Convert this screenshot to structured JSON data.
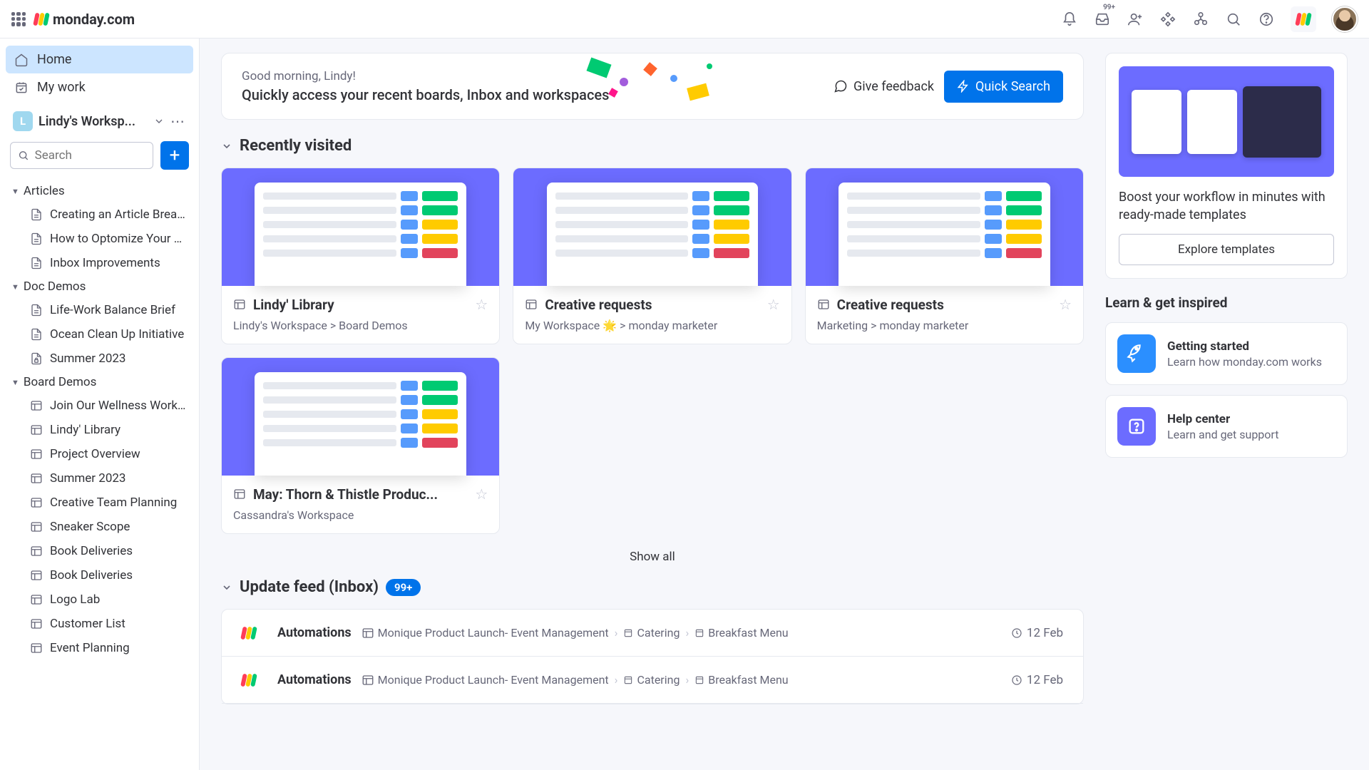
{
  "brand": "monday.com",
  "topbar": {
    "inbox_badge": "99+"
  },
  "sidebar": {
    "home": "Home",
    "mywork": "My work",
    "workspace": {
      "initial": "L",
      "name": "Lindy's Worksp..."
    },
    "search_placeholder": "Search",
    "groups": [
      {
        "name": "Articles",
        "type": "folder",
        "children": [
          {
            "label": "Creating an Article Break...",
            "type": "doc"
          },
          {
            "label": "How to Optomize Your A...",
            "type": "doc"
          },
          {
            "label": "Inbox Improvements",
            "type": "doc"
          }
        ]
      },
      {
        "name": "Doc Demos",
        "type": "folder",
        "children": [
          {
            "label": "Life-Work Balance Brief",
            "type": "doc"
          },
          {
            "label": "Ocean Clean Up Initiative",
            "type": "doc"
          },
          {
            "label": "Summer 2023",
            "type": "doc-locked"
          }
        ]
      },
      {
        "name": "Board Demos",
        "type": "folder",
        "children": [
          {
            "label": "Join Our Wellness Works...",
            "type": "board"
          },
          {
            "label": "Lindy' Library",
            "type": "board"
          },
          {
            "label": "Project Overview",
            "type": "board"
          },
          {
            "label": "Summer 2023",
            "type": "board"
          },
          {
            "label": "Creative Team Planning",
            "type": "board"
          },
          {
            "label": "Sneaker Scope",
            "type": "board"
          },
          {
            "label": "Book Deliveries",
            "type": "board"
          },
          {
            "label": "Book Deliveries",
            "type": "board"
          },
          {
            "label": "Logo Lab",
            "type": "board"
          },
          {
            "label": "Customer List",
            "type": "board"
          },
          {
            "label": "Event Planning",
            "type": "board"
          }
        ]
      }
    ]
  },
  "hero": {
    "greeting": "Good morning, Lindy!",
    "subtitle": "Quickly access your recent boards, Inbox and workspaces",
    "feedback": "Give feedback",
    "quick_search": "Quick Search"
  },
  "recent": {
    "title": "Recently visited",
    "show_all": "Show all",
    "cards": [
      {
        "title": "Lindy' Library",
        "path": "Lindy's Workspace > Board Demos",
        "icon": "board-share"
      },
      {
        "title": "Creative requests",
        "path": "My Workspace 🌟 > monday marketer",
        "icon": "board"
      },
      {
        "title": "Creative requests",
        "path": "Marketing > monday marketer",
        "icon": "board"
      },
      {
        "title": "May: Thorn & Thistle Produc...",
        "path": "Cassandra's Workspace",
        "icon": "board"
      }
    ]
  },
  "feed": {
    "title": "Update feed (Inbox)",
    "badge": "99+",
    "items": [
      {
        "author": "Automations",
        "path": [
          "Monique Product Launch- Event Management",
          "Catering",
          "Breakfast Menu"
        ],
        "time": "12 Feb"
      },
      {
        "author": "Automations",
        "path": [
          "Monique Product Launch- Event Management",
          "Catering",
          "Breakfast Menu"
        ],
        "time": "12 Feb"
      }
    ]
  },
  "side": {
    "templates_text": "Boost your workflow in minutes with ready-made templates",
    "explore": "Explore templates",
    "learn_title": "Learn & get inspired",
    "learn": [
      {
        "title": "Getting started",
        "sub": "Learn how monday.com works",
        "kind": "rocket"
      },
      {
        "title": "Help center",
        "sub": "Learn and get support",
        "kind": "help"
      }
    ]
  }
}
